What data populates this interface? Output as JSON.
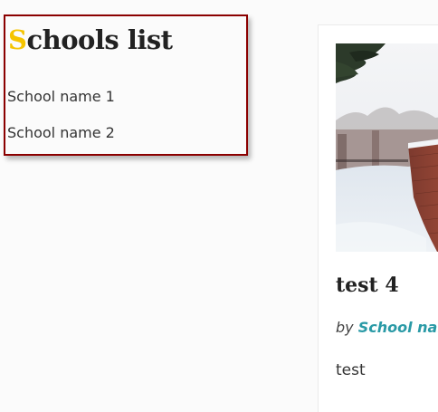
{
  "schools_widget": {
    "title_first_letter": "S",
    "title_rest": "chools list",
    "items": [
      {
        "label": "School name 1"
      },
      {
        "label": "School name 2"
      }
    ]
  },
  "post": {
    "title": "test 4",
    "byline_prefix": "by",
    "author": "School nam",
    "excerpt": "test"
  },
  "colors": {
    "widget_border": "#8b0000",
    "title_accent": "#f5c400",
    "author_link": "#2a9aa6"
  }
}
